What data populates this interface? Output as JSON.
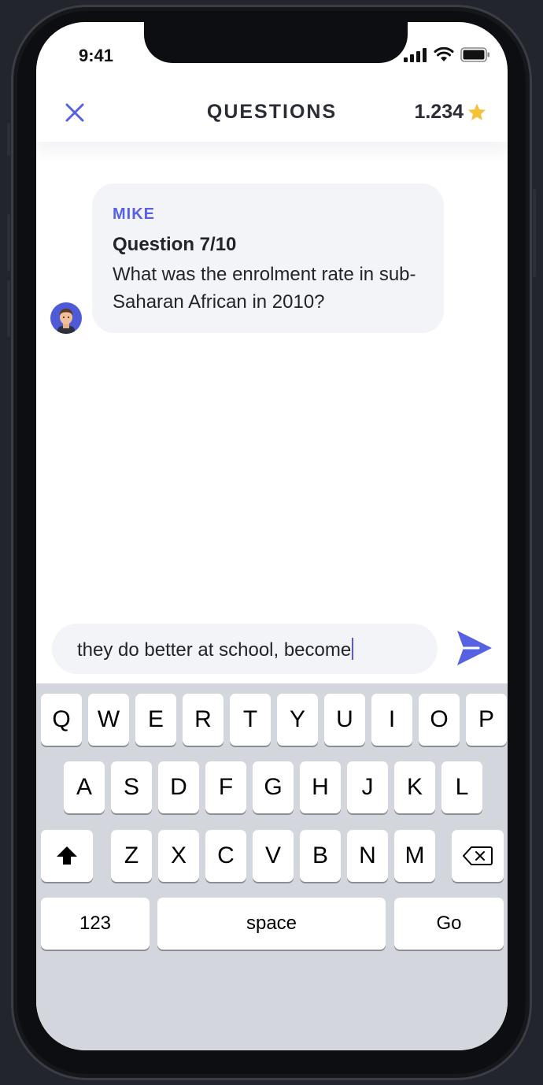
{
  "status_bar": {
    "time": "9:41"
  },
  "header": {
    "title": "QUESTIONS",
    "score": "1.234"
  },
  "message": {
    "sender": "MIKE",
    "question_label": "Question 7/10",
    "question_text": "What was the enrolment rate in sub-Saharan African in 2010?"
  },
  "composer": {
    "value": "they do better at school, become"
  },
  "keyboard": {
    "row1": [
      "Q",
      "W",
      "E",
      "R",
      "T",
      "Y",
      "U",
      "I",
      "O",
      "P"
    ],
    "row2": [
      "A",
      "S",
      "D",
      "F",
      "G",
      "H",
      "J",
      "K",
      "L"
    ],
    "row3": [
      "Z",
      "X",
      "C",
      "V",
      "B",
      "N",
      "M"
    ],
    "numbers_label": "123",
    "space_label": "space",
    "go_label": "Go"
  },
  "colors": {
    "accent": "#5761e3",
    "star": "#f5c23a",
    "bubble": "#f3f4f8",
    "keyboard_bg": "#d3d6dd"
  }
}
